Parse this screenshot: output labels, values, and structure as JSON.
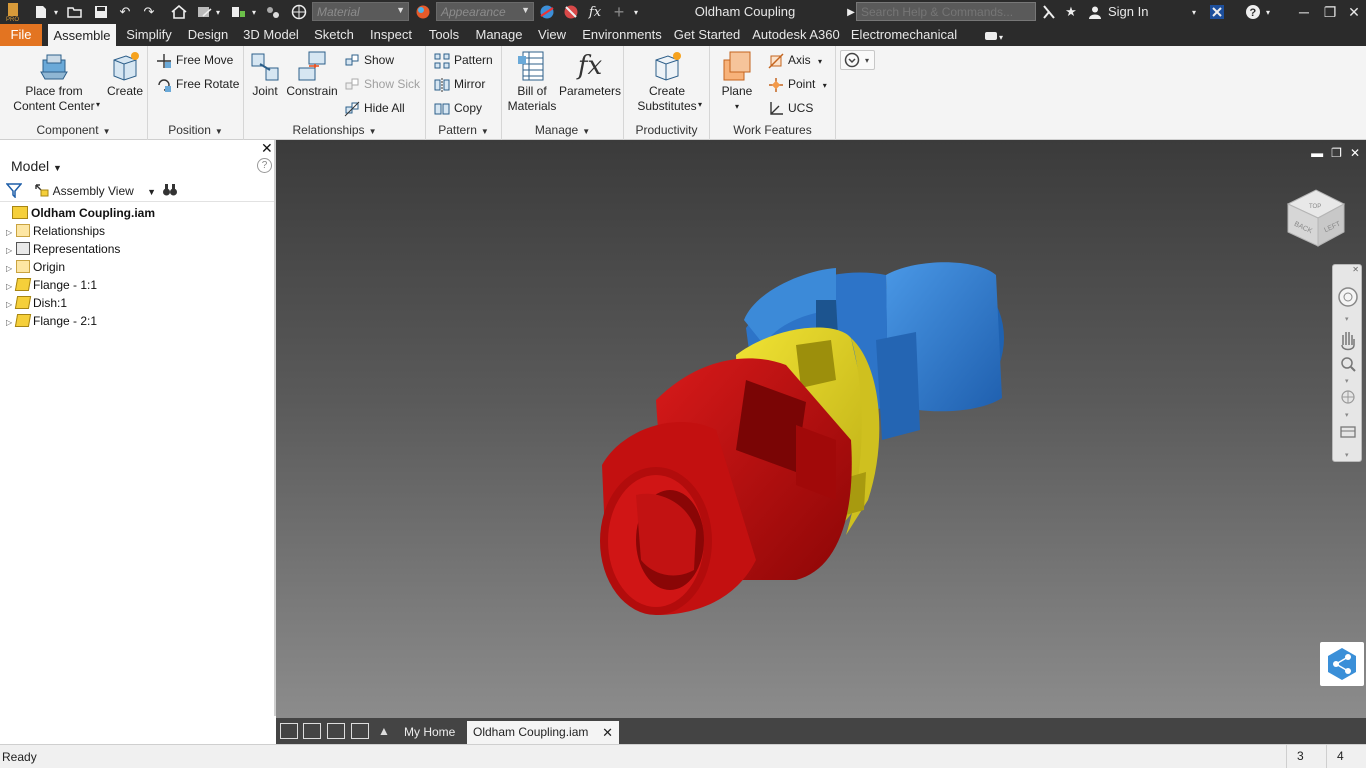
{
  "titlebar": {
    "app_title": "Oldham Coupling",
    "material_placeholder": "Material",
    "appearance_placeholder": "Appearance",
    "fx_label": "fx",
    "search_placeholder": "Search Help & Commands...",
    "signin_label": "Sign In"
  },
  "menu": {
    "tabs": [
      "File",
      "Assemble",
      "Simplify",
      "Design",
      "3D Model",
      "Sketch",
      "Inspect",
      "Tools",
      "Manage",
      "View",
      "Environments",
      "Get Started",
      "Autodesk A360",
      "Electromechanical"
    ]
  },
  "ribbon": {
    "component": {
      "label": "Component",
      "place_content_center": "Place from Content Center",
      "create": "Create"
    },
    "position": {
      "label": "Position",
      "free_move": "Free Move",
      "free_rotate": "Free Rotate"
    },
    "relationships": {
      "label": "Relationships",
      "joint": "Joint",
      "constrain": "Constrain",
      "show": "Show",
      "show_sick": "Show Sick",
      "hide_all": "Hide All"
    },
    "pattern": {
      "label": "Pattern",
      "pattern": "Pattern",
      "mirror": "Mirror",
      "copy": "Copy"
    },
    "manage": {
      "label": "Manage",
      "bom": "Bill of Materials",
      "parameters": "Parameters",
      "fx_glyph": "fx"
    },
    "productivity": {
      "label": "Productivity",
      "create_substitutes": "Create Substitutes"
    },
    "work_features": {
      "label": "Work Features",
      "plane": "Plane",
      "axis": "Axis",
      "point": "Point",
      "ucs": "UCS"
    }
  },
  "browser": {
    "title": "Model",
    "help_glyph": "?",
    "view_label": "Assembly View",
    "root": "Oldham Coupling.iam",
    "items": [
      "Relationships",
      "Representations",
      "Origin",
      "Flange - 1:1",
      "Dish:1",
      "Flange - 2:1"
    ]
  },
  "viewcube": {
    "face_top": "TOP",
    "face_back": "BACK",
    "face_left": "LEFT"
  },
  "doctabs": {
    "home": "My Home",
    "document": "Oldham Coupling.iam"
  },
  "status": {
    "text": "Ready",
    "num1": "3",
    "num2": "4"
  },
  "colors": {
    "file_tab": "#e37421",
    "flange1": "#c00d0d",
    "dish": "#e6d521",
    "flange2": "#2f7bd0",
    "share_button": "#3a8fd8"
  }
}
